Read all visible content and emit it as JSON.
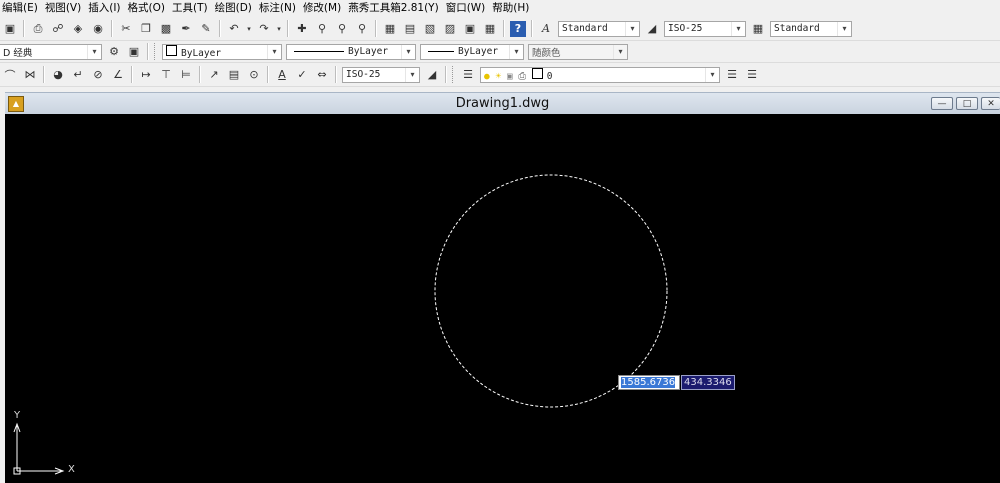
{
  "menu": [
    "编辑(E)",
    "视图(V)",
    "插入(I)",
    "格式(O)",
    "工具(T)",
    "绘图(D)",
    "标注(N)",
    "修改(M)",
    "燕秀工具箱2.81(Y)",
    "窗口(W)",
    "帮助(H)"
  ],
  "toolbar2": {
    "workspace": "经典",
    "workspace_prefix": "D",
    "layer_color": "ByLayer",
    "linetype": "ByLayer",
    "lineweight": "ByLayer",
    "plot_color": "随颜色"
  },
  "toolbar1": {
    "text_style": "Standard",
    "dim_style": "ISO-25",
    "table_style": "Standard"
  },
  "toolbar3": {
    "dim_style": "ISO-25",
    "layer": "0"
  },
  "window": {
    "title": "Drawing1.dwg"
  },
  "canvas": {
    "input_x": "1585.6736",
    "input_y": "434.3346",
    "axis_x": "X",
    "axis_y": "Y"
  },
  "colors": {
    "canvas_bg": "#000000",
    "dashed_circle": "#ffffff",
    "input_highlight": "#3a78d6",
    "input2_bg": "#1b1b6e"
  }
}
